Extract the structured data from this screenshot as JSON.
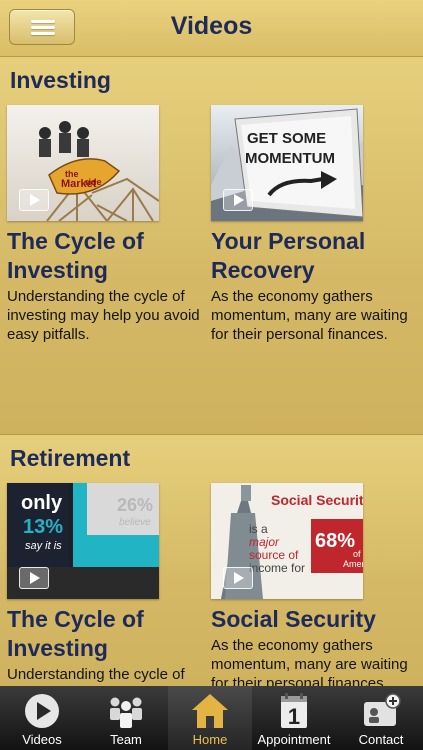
{
  "header": {
    "title": "Videos",
    "menu_icon": "hamburger-menu-icon"
  },
  "sections": [
    {
      "title": "Investing",
      "cards": [
        {
          "thumb_text": [
            "the",
            "Market",
            "ride"
          ],
          "title": "The Cycle of Investing",
          "description": "Understanding the cycle of investing may help you avoid easy pitfalls."
        },
        {
          "thumb_text": [
            "GET SOME",
            "MOMENTUM"
          ],
          "title": "Your Personal Recovery",
          "description": "As the economy gathers momentum, many are waiting for their personal finances."
        }
      ]
    },
    {
      "title": "Retirement",
      "cards": [
        {
          "thumb_text": [
            "only",
            "13%",
            "say it is",
            "26%",
            "believe"
          ],
          "title": "The Cycle of Investing",
          "description": "Understanding the cycle of investing may help you avoid easy pitfalls."
        },
        {
          "thumb_text": [
            "Social Securit",
            "is a",
            "major",
            "source of",
            "income for",
            "68%",
            "of",
            "Americ"
          ],
          "title": "Social Security",
          "description": "As the economy gathers momentum, many are waiting for their personal finances."
        }
      ]
    }
  ],
  "tabbar": {
    "tabs": [
      {
        "label": "Videos",
        "icon": "play-circle-icon",
        "active": false
      },
      {
        "label": "Team",
        "icon": "team-icon",
        "active": false
      },
      {
        "label": "Home",
        "icon": "home-icon",
        "active": true
      },
      {
        "label": "Appointment",
        "icon": "calendar-icon",
        "calendar_day": "1",
        "active": false
      },
      {
        "label": "Contact",
        "icon": "contact-card-icon",
        "active": false
      }
    ]
  },
  "colors": {
    "gold_background": "#d4b865",
    "title_navy": "#1e2a5a",
    "tabbar": "#1c1c1c",
    "active_tab_label": "#e8c052"
  }
}
